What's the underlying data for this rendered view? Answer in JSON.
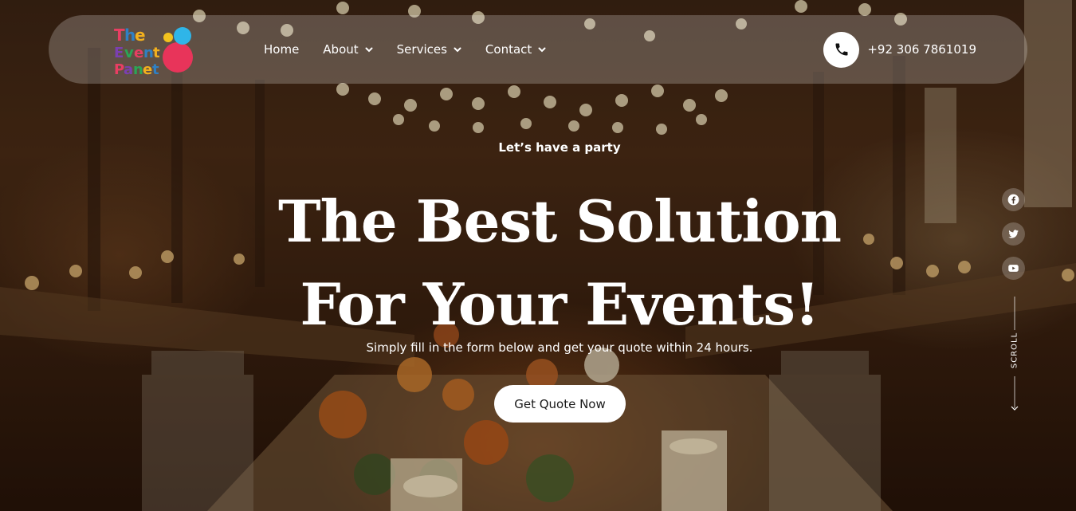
{
  "brand": {
    "logo_text": "The Event Panet"
  },
  "nav": {
    "items": [
      {
        "label": "Home",
        "has_dropdown": false
      },
      {
        "label": "About",
        "has_dropdown": true
      },
      {
        "label": "Services",
        "has_dropdown": true
      },
      {
        "label": "Contact",
        "has_dropdown": true
      }
    ],
    "phone": {
      "icon": "phone-icon",
      "number": "+92 306 7861019"
    }
  },
  "hero": {
    "eyebrow": "Let’s have a party",
    "headline_line1": "The Best Solution",
    "headline_line2": "For Your Events!",
    "subline": "Simply fill in the form below and get your quote within 24 hours.",
    "cta_label": "Get Quote Now"
  },
  "social": [
    {
      "icon": "facebook-icon"
    },
    {
      "icon": "twitter-icon"
    },
    {
      "icon": "youtube-icon"
    }
  ],
  "scroll": {
    "label": "SCROLL",
    "icon": "arrow-down-icon"
  },
  "colors": {
    "text": "#ffffff",
    "button_bg": "#ffffff",
    "button_text": "#1a1a1a",
    "navbar_glass": "rgba(255,255,255,0.22)"
  }
}
